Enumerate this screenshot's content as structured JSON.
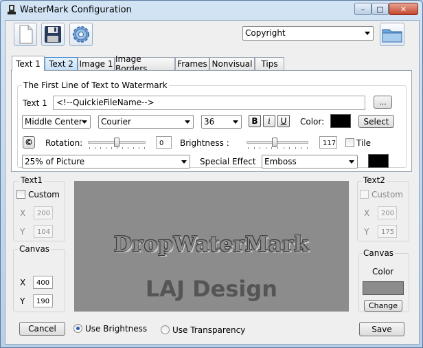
{
  "window": {
    "title": "WaterMark Configuration",
    "controls": {
      "minimize": "–",
      "maximize": "□",
      "close": "✕"
    }
  },
  "toolbar": {
    "icons": [
      "new-document-icon",
      "save-floppy-icon",
      "settings-gear-icon",
      "open-folder-icon"
    ],
    "watermark_select": "Copyright"
  },
  "tabs": [
    {
      "label": "Text 1"
    },
    {
      "label": "Text 2"
    },
    {
      "label": "Image 1"
    },
    {
      "label": "Image Borders"
    },
    {
      "label": "Frames"
    },
    {
      "label": "Nonvisual"
    },
    {
      "label": "Tips"
    }
  ],
  "text_panel": {
    "group_title": "The First Line of Text to Watermark",
    "text1_label": "Text 1",
    "text1_value": "<!--QuickieFileName-->",
    "browse_button": "...",
    "position": "Middle Center",
    "font": "Courier",
    "size": "36",
    "bold": "B",
    "italic": "i",
    "underline": "U",
    "color_label": "Color:",
    "color_value": "#000000",
    "select_button": "Select",
    "copyright_button": "©",
    "rotation_label": "Rotation:",
    "rotation_value": "0",
    "rotation_level": 0.5,
    "brightness_label": "Brightness :",
    "brightness_value": "117",
    "brightness_level": 0.46,
    "tile_label": "Tile",
    "scale": "25% of Picture",
    "special_effect_label": "Special Effect",
    "special_effect": "Emboss",
    "effect_color": "#000000"
  },
  "text1_group": {
    "title": "Text1",
    "custom_label": "Custom",
    "x_label": "X",
    "x_value": "200",
    "y_label": "Y",
    "y_value": "104"
  },
  "text2_group": {
    "title": "Text2",
    "custom_label": "Custom",
    "x_label": "X",
    "x_value": "200",
    "y_label": "Y",
    "y_value": "175"
  },
  "canvas_left": {
    "title": "Canvas",
    "x_label": "X",
    "x_value": "400",
    "y_label": "Y",
    "y_value": "190"
  },
  "canvas_right": {
    "title": "Canvas",
    "color_label": "Color",
    "color_value": "#8c8c8c",
    "change_button": "Change"
  },
  "preview": {
    "line1": "DropWaterMark",
    "line2": "LAJ Design"
  },
  "footer": {
    "cancel_button": "Cancel",
    "use_brightness": "Use Brightness",
    "use_transparency": "Use Transparency",
    "save_button": "Save"
  }
}
